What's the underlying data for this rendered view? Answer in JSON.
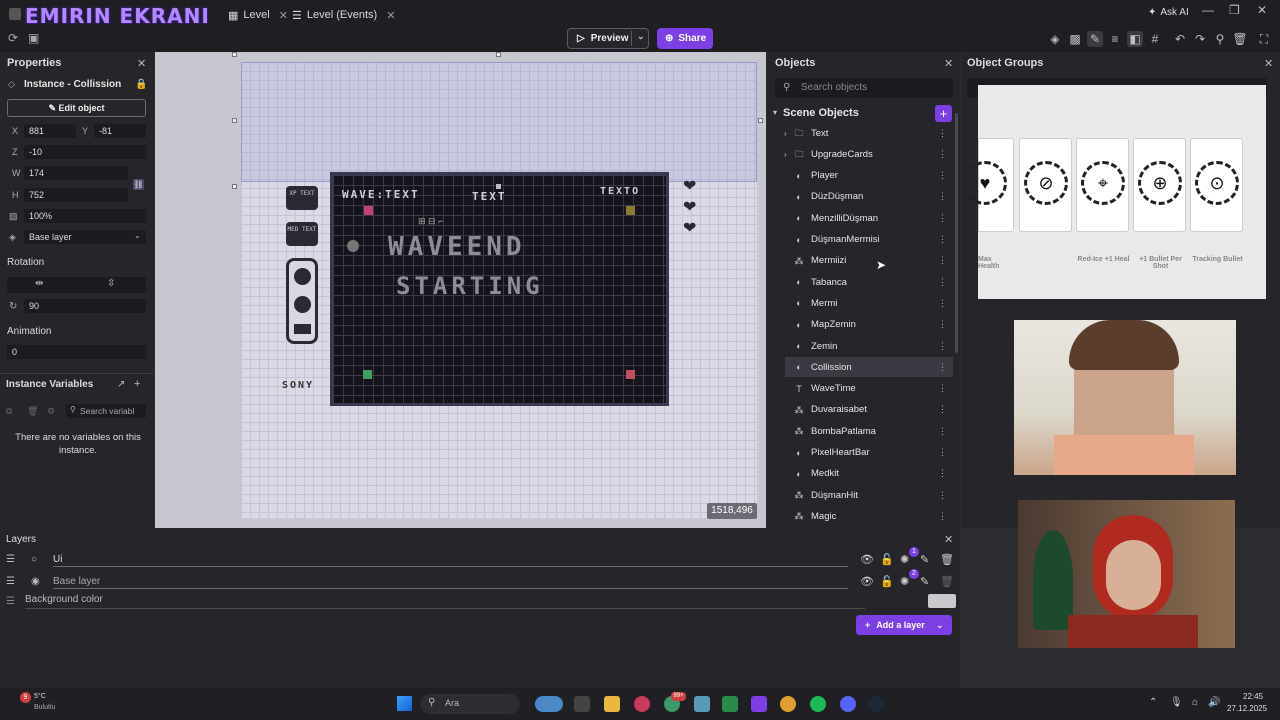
{
  "window": {
    "brand": "EMIRIN EKRANI",
    "tabs": [
      {
        "label": "Level"
      },
      {
        "label": "Level (Events)"
      }
    ],
    "ask_ai": "Ask AI"
  },
  "toolbar": {
    "preview_label": "Preview",
    "share_label": "Share",
    "icons": [
      "cube-icon",
      "grid-cube-icon",
      "pencil-icon",
      "list-icon",
      "layers-icon",
      "hash-grid-icon",
      "undo-icon",
      "redo-icon",
      "zoom-icon",
      "trash-icon",
      "fullscreen-icon"
    ]
  },
  "properties": {
    "title": "Properties",
    "instance_label": "Instance - Collission",
    "edit_object": "Edit object",
    "x_label": "X",
    "x_value": "881",
    "y_label": "Y",
    "y_value": "-81",
    "z_label": "Z",
    "z_value": "-10",
    "w_label": "W",
    "w_value": "174",
    "h_label": "H",
    "h_value": "752",
    "opacity_value": "100%",
    "layer_value": "Base layer",
    "rotation_title": "Rotation",
    "angle_value": "90",
    "animation_title": "Animation",
    "animation_value": "0",
    "instance_vars_title": "Instance Variables",
    "search_vars_placeholder": "Search variabl",
    "no_vars_text": "There are no variables on this instance."
  },
  "canvas": {
    "coords": "1518,496",
    "game_text": {
      "wave_text": "WAVE:TEXT",
      "text": "TEXT",
      "texto": "TEXTO",
      "big_1": "WAVEEND",
      "big_2": "STARTING",
      "sony": "SONY",
      "xp_text": "XP TEXT",
      "med_text": "MED TEXT"
    }
  },
  "objects": {
    "title": "Objects",
    "search_placeholder": "Search objects",
    "scene_objects": "Scene Objects",
    "items": [
      {
        "name": "Text",
        "icon": "folder-icon"
      },
      {
        "name": "UpgradeCards",
        "icon": "folder-icon"
      },
      {
        "name": "Player",
        "icon": "sprite-icon"
      },
      {
        "name": "DüzDüşman",
        "icon": "sprite-icon"
      },
      {
        "name": "MenzilliDüşman",
        "icon": "sprite-icon"
      },
      {
        "name": "DüşmanMermisi",
        "icon": "sprite-icon"
      },
      {
        "name": "Mermiizi",
        "icon": "particles-icon"
      },
      {
        "name": "Tabanca",
        "icon": "sprite-icon"
      },
      {
        "name": "Mermi",
        "icon": "sprite-icon"
      },
      {
        "name": "MapZemin",
        "icon": "sprite-icon"
      },
      {
        "name": "Zemin",
        "icon": "sprite-icon"
      },
      {
        "name": "Collission",
        "icon": "sprite-icon"
      },
      {
        "name": "WaveTime",
        "icon": "text-icon"
      },
      {
        "name": "Duvaraisabet",
        "icon": "particles-icon"
      },
      {
        "name": "BombaPatlama",
        "icon": "particles-icon"
      },
      {
        "name": "PixelHeartBar",
        "icon": "sprite-icon"
      },
      {
        "name": "Medkit",
        "icon": "sprite-icon"
      },
      {
        "name": "DüşmanHit",
        "icon": "particles-icon"
      },
      {
        "name": "Magic",
        "icon": "particles-icon"
      }
    ]
  },
  "object_groups": {
    "title": "Object Groups",
    "cards": [
      {
        "label": "Max Health"
      },
      {
        "label": ""
      },
      {
        "label": "Red-Ice +1 Heal"
      },
      {
        "label": "+1 Bullet Per Shot"
      },
      {
        "label": "Tracking Bullet"
      }
    ]
  },
  "layers": {
    "title": "Layers",
    "rows": [
      {
        "name": "Ui",
        "badge": "1"
      },
      {
        "name": "Base layer",
        "badge": "2"
      }
    ],
    "background_color": "Background color",
    "add_layer": "Add a layer"
  },
  "taskbar": {
    "weather_temp": "5°C",
    "weather_desc": "Bulutlu",
    "search_label": "Ara",
    "time": "22:45",
    "date": "27.12.2025",
    "badge": "99+"
  },
  "colors": {
    "accent": "#7b3fe4",
    "panel": "#26262a",
    "canvas": "#dadae6"
  }
}
